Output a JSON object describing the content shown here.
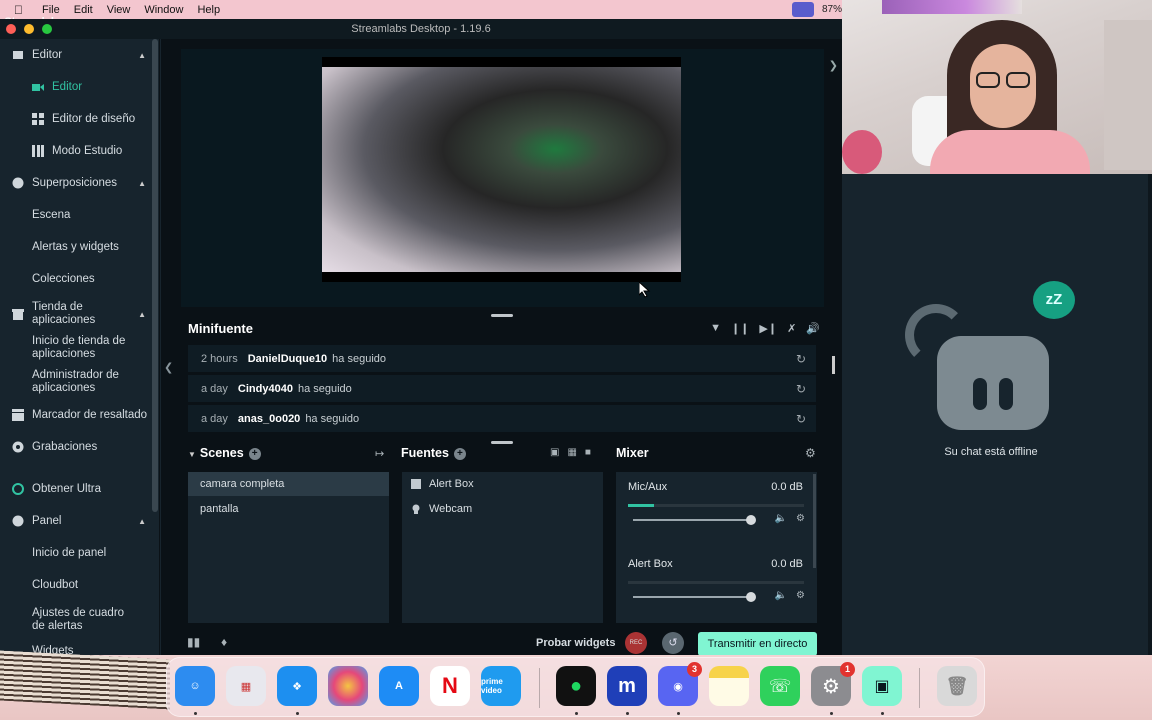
{
  "menubar": {
    "app_name": "Streamlabs Desktop",
    "items": [
      "File",
      "Edit",
      "View",
      "Window",
      "Help"
    ],
    "battery": "87%"
  },
  "window": {
    "title": "Streamlabs Desktop - 1.19.6"
  },
  "sidebar": {
    "items": [
      {
        "label": "Editor",
        "icon": "editor-icon"
      },
      {
        "label": "Editor",
        "icon": "video-camera-icon"
      },
      {
        "label": "Editor de diseño",
        "icon": "layout-grid-icon"
      },
      {
        "label": "Modo Estudio",
        "icon": "studio-columns-icon"
      },
      {
        "label": "Superposiciones",
        "icon": "palette-icon"
      },
      {
        "label": "Escena"
      },
      {
        "label": "Alertas y widgets"
      },
      {
        "label": "Colecciones"
      },
      {
        "label": "Tienda de aplicaciones",
        "icon": "store-icon"
      },
      {
        "label": "Inicio de tienda de aplicaciones"
      },
      {
        "label": "Administrador de aplicaciones"
      },
      {
        "label": "Marcador de resaltado",
        "icon": "clapper-icon"
      },
      {
        "label": "Grabaciones",
        "icon": "record-icon"
      },
      {
        "label": "Obtener Ultra",
        "icon": "ultra-icon"
      },
      {
        "label": "Panel",
        "icon": "dashboard-icon"
      },
      {
        "label": "Inicio de panel"
      },
      {
        "label": "Cloudbot"
      },
      {
        "label": "Ajustes de cuadro de alertas"
      },
      {
        "label": "Widgets"
      }
    ]
  },
  "minifuente": {
    "title": "Minifuente",
    "events": [
      {
        "time": "2 hours",
        "user": "DanielDuque10",
        "action": "ha seguido"
      },
      {
        "time": "a day",
        "user": "Cindy4040",
        "action": "ha seguido"
      },
      {
        "time": "a day",
        "user": "anas_0o020",
        "action": "ha seguido"
      }
    ]
  },
  "scenes": {
    "title": "Scenes",
    "items": [
      "camara completa",
      "pantalla"
    ],
    "selected": "camara completa"
  },
  "sources": {
    "title": "Fuentes",
    "items": [
      {
        "label": "Alert Box",
        "icon": "alert-box-icon"
      },
      {
        "label": "Webcam",
        "icon": "webcam-icon"
      }
    ]
  },
  "mixer": {
    "title": "Mixer",
    "channels": [
      {
        "name": "Mic/Aux",
        "db": "0.0 dB",
        "meter_level": 0.15
      },
      {
        "name": "Alert Box",
        "db": "0.0 dB",
        "meter_level": 0.0
      }
    ]
  },
  "footer": {
    "probar_label": "Probar widgets",
    "rec_label": "REC",
    "golive_label": "Transmitir en directo"
  },
  "chat": {
    "offline_text": "Su chat está offline",
    "zz": "zZ"
  },
  "dock": {
    "apps": [
      {
        "name": "Finder",
        "color": "#2d8cf0"
      },
      {
        "name": "Launchpad",
        "color": "#e8e8ee"
      },
      {
        "name": "Safari",
        "color": "#1d8ff0"
      },
      {
        "name": "Photos",
        "color": "#f4f4f4"
      },
      {
        "name": "App Store",
        "color": "#1e8cf5"
      },
      {
        "name": "Netflix",
        "color": "#fff"
      },
      {
        "name": "Prime Video",
        "color": "#1f9bef"
      },
      {
        "name": "Spotify",
        "color": "#111"
      },
      {
        "name": "m",
        "color": "#1f3fb8"
      },
      {
        "name": "Discord",
        "color": "#5865f2",
        "badge": "3"
      },
      {
        "name": "Notes",
        "color": "#f7d34a"
      },
      {
        "name": "WhatsApp",
        "color": "#2fd15c"
      },
      {
        "name": "System Settings",
        "color": "#8c8c90",
        "badge": "1"
      },
      {
        "name": "Streamlabs",
        "color": "#80f5d2"
      },
      {
        "name": "Trash",
        "color": "#d9d9d9"
      }
    ],
    "prime_label": "prime video",
    "netflix_label": "N",
    "m_label": "m"
  }
}
